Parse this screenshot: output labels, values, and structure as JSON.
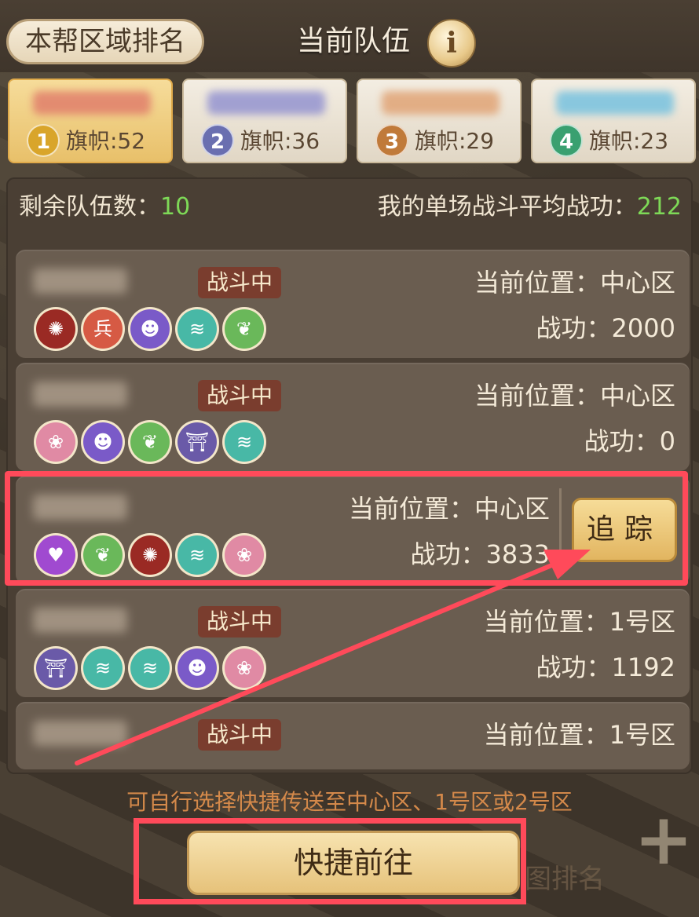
{
  "header": {
    "region_rank_label": "本帮区域排名",
    "title": "当前队伍",
    "info_glyph": "i"
  },
  "rank_tabs": [
    {
      "rank": "1",
      "flags": "旗帜:52",
      "medal_color": "#d9a52a",
      "name_color": "#e07a6a"
    },
    {
      "rank": "2",
      "flags": "旗帜:36",
      "medal_color": "#6a6fb0",
      "name_color": "#8f8fd0"
    },
    {
      "rank": "3",
      "flags": "旗帜:29",
      "medal_color": "#c07a3a",
      "name_color": "#e0a070"
    },
    {
      "rank": "4",
      "flags": "旗帜:23",
      "medal_color": "#3aa070",
      "name_color": "#70c0e0"
    }
  ],
  "summary": {
    "remaining_label": "剩余队伍数：",
    "remaining_value": "10",
    "avg_label": "我的单场战斗平均战功：",
    "avg_value": "212"
  },
  "teams": [
    {
      "status": "战斗中",
      "location": "当前位置：中心区",
      "merit": "战功：2000",
      "members": [
        "crimson-spirit",
        "red-soldier",
        "purple-face",
        "teal-wave",
        "green-leaf"
      ]
    },
    {
      "status": "战斗中",
      "location": "当前位置：中心区",
      "merit": "战功：0",
      "members": [
        "pink-lotus",
        "purple-face",
        "green-leaf",
        "purple-pagoda",
        "teal-wave"
      ]
    },
    {
      "status": "",
      "location": "当前位置：中心区",
      "merit": "战功：3833",
      "members": [
        "violet-heart",
        "green-leaf",
        "crimson-spirit",
        "teal-wave",
        "pink-lotus"
      ]
    },
    {
      "status": "战斗中",
      "location": "当前位置：1号区",
      "merit": "战功：1192",
      "members": [
        "purple-pagoda",
        "teal-wave",
        "teal-wave",
        "purple-face",
        "pink-lotus"
      ]
    },
    {
      "status": "战斗中",
      "location": "当前位置：1号区",
      "merit": "",
      "members": []
    }
  ],
  "track_button": "追踪",
  "hint": "可自行选择快捷传送至中心区、1号区或2号区",
  "quick_go_button": "快捷前往",
  "map_rank_label": "图排名",
  "plus_glyph": "+",
  "colors": {
    "accent_green": "#7ed957",
    "highlight_red": "#ff4a5a",
    "hint_orange": "#d4894a"
  }
}
